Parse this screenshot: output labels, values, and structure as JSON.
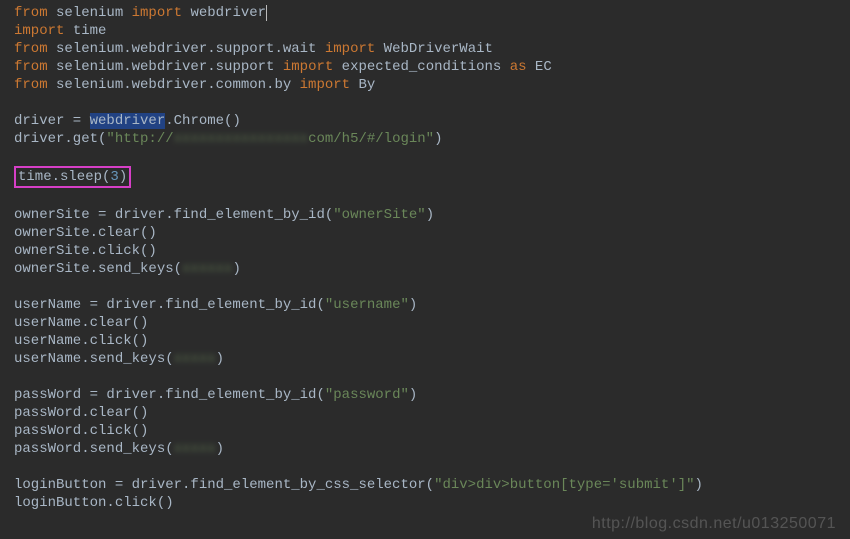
{
  "code": {
    "l1_from": "from",
    "l1_path": " selenium ",
    "l1_import": "import",
    "l1_target": " webdriver",
    "l2_import": "import",
    "l2_target": " time",
    "l3_from": "from",
    "l3_path": " selenium.webdriver.support.wait ",
    "l3_import": "import",
    "l3_target": " WebDriverWait",
    "l4_from": "from",
    "l4_path": " selenium.webdriver.support ",
    "l4_import": "import",
    "l4_target": " expected_conditions ",
    "l4_as": "as",
    "l4_alias": " EC",
    "l5_from": "from",
    "l5_path": " selenium.webdriver.common.by ",
    "l5_import": "import",
    "l5_target": " By",
    "l7": "driver = ",
    "l7_hl": "webdriver",
    "l7_rest": ".Chrome()",
    "l8_a": "driver.get(",
    "l8_s1": "\"http://",
    "l8_blur": "xxxxxxxxxxxxxxxx",
    "l8_s2": "com/h5/#/login\"",
    "l8_b": ")",
    "l10_box": "time.sleep(",
    "l10_num": "3",
    "l10_box_end": ")",
    "l12_a": "ownerSite = driver.find_element_by_id(",
    "l12_s": "\"ownerSite\"",
    "l12_b": ")",
    "l13": "ownerSite.clear()",
    "l14": "ownerSite.click()",
    "l15_a": "ownerSite.send_keys(",
    "l15_blur": "xxxxxx",
    "l15_b": ")",
    "l17_a": "userName = driver.find_element_by_id(",
    "l17_s": "\"username\"",
    "l17_b": ")",
    "l18": "userName.clear()",
    "l19": "userName.click()",
    "l20_a": "userName.send_keys(",
    "l20_blur": "xxxxx",
    "l20_b": ")",
    "l22_a": "passWord = driver.find_element_by_id(",
    "l22_s": "\"password\"",
    "l22_b": ")",
    "l23": "passWord.clear()",
    "l24": "passWord.click()",
    "l25_a": "passWord.send_keys(",
    "l25_blur": "xxxxx",
    "l25_b": ")",
    "l27_a": "loginButton = driver.find_element_by_css_selector(",
    "l27_s": "\"div>div>button[type='submit']\"",
    "l27_b": ")",
    "l28": "loginButton.click()"
  },
  "watermark": "http://blog.csdn.net/u013250071"
}
